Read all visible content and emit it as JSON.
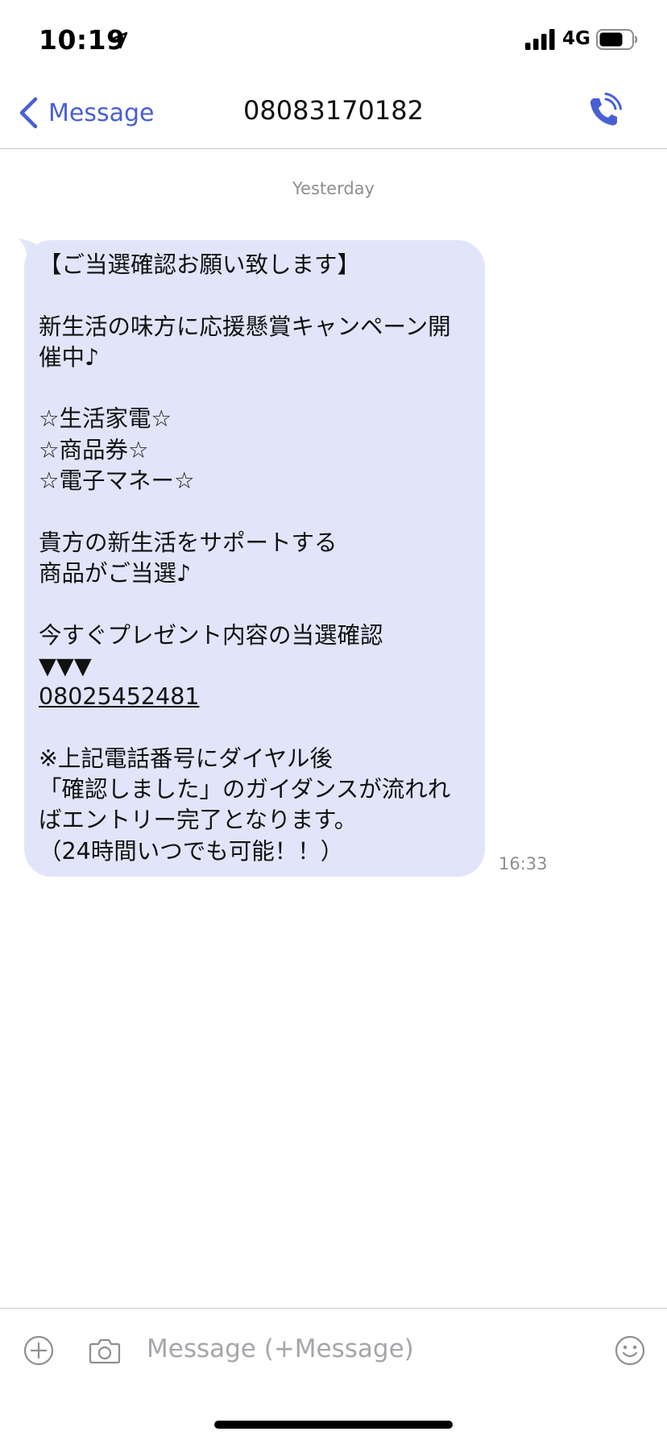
{
  "status_bar": {
    "time": "10:19",
    "network": "4G",
    "icons": [
      "location-arrow-icon",
      "signal-bars-icon",
      "battery-icon"
    ]
  },
  "nav": {
    "back_label": "Message",
    "title": "08083170182",
    "accent_color": "#4a5fd6",
    "icons": [
      "chevron-left-icon",
      "phone-call-icon"
    ]
  },
  "conversation": {
    "date_label": "Yesterday",
    "message": {
      "bubble_color": "#e2e5fa",
      "time": "16:33",
      "lines": [
        "【ご当選確認お願い致します】",
        "",
        "新生活の味方に応援懸賞キャンペーン開",
        "催中♪",
        "",
        "☆生活家電☆",
        "☆商品券☆",
        "☆電子マネー☆",
        "",
        "貴方の新生活をサポートする",
        "商品がご当選♪",
        "",
        "今すぐプレゼント内容の当選確認",
        "▼▼▼",
        "08025452481",
        "",
        "※上記電話番号にダイヤル後",
        "「確認しました」のガイダンスが流れれ",
        "ばエントリー完了となります。",
        "（24時間いつでも可能！！）"
      ]
    }
  },
  "input_bar": {
    "placeholder": "Message (+Message)",
    "value": "",
    "icons": [
      "add-circle-icon",
      "camera-icon",
      "emoji-icon"
    ]
  }
}
